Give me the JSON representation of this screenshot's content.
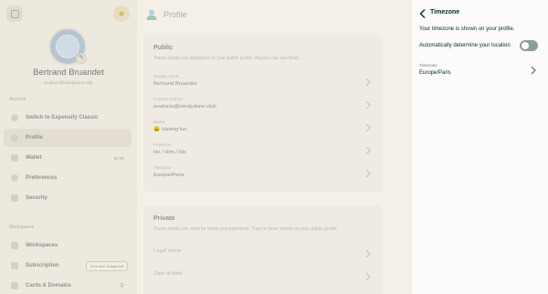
{
  "sidebar": {
    "user_name": "Bertrand Bruandet",
    "user_email": "products@mindydone.club",
    "sections": {
      "account": "Account",
      "workspaces": "Workspaces"
    },
    "items": [
      {
        "label": "Switch to Expensify Classic",
        "icon": "swap-icon"
      },
      {
        "label": "Profile",
        "icon": "person-icon",
        "active": true
      },
      {
        "label": "Wallet",
        "icon": "wallet-icon",
        "tail": "$0.00"
      },
      {
        "label": "Preferences",
        "icon": "gear-icon"
      },
      {
        "label": "Security",
        "icon": "lock-icon"
      },
      {
        "label": "Workspaces",
        "icon": "building-icon"
      },
      {
        "label": "Subscription",
        "icon": "card-icon",
        "badge": "Free trial: 3 days left"
      },
      {
        "label": "Cards & Domains",
        "icon": "domain-icon"
      }
    ]
  },
  "main": {
    "title": "Profile",
    "public": {
      "heading": "Public",
      "subtitle": "These details are displayed on your public profile. Anyone can see them.",
      "fields": [
        {
          "label": "Display name",
          "value": "Bertrand Bruandet"
        },
        {
          "label": "Contact method",
          "value": "products@mindydone.club"
        },
        {
          "label": "Status",
          "value": "😀 Having fun"
        },
        {
          "label": "Pronouns",
          "value": "He / Him / His"
        },
        {
          "label": "Timezone",
          "value": "Europe/Paris"
        }
      ]
    },
    "private": {
      "heading": "Private",
      "subtitle": "These details are used for travel and payments. They're never shown on your public profile.",
      "fields": [
        {
          "label": "Legal name"
        },
        {
          "label": "Date of birth"
        }
      ]
    }
  },
  "panel": {
    "title": "Timezone",
    "description": "Your timezone is shown on your profile.",
    "auto_label": "Automatically determine your location",
    "auto_enabled": false,
    "timezone_label": "Timezone",
    "timezone_value": "Europe/Paris"
  }
}
